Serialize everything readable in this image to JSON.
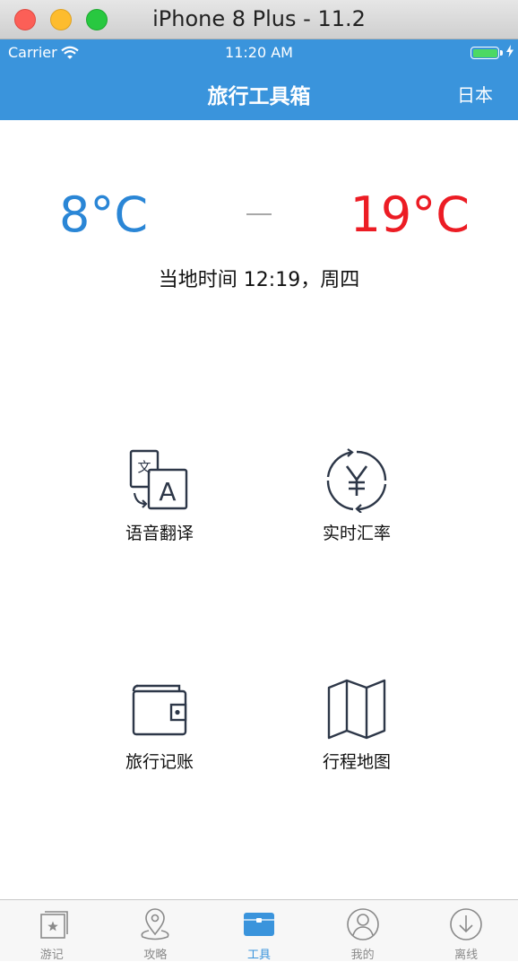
{
  "window": {
    "title": "iPhone 8 Plus - 11.2"
  },
  "status_bar": {
    "carrier": "Carrier",
    "time": "11:20 AM",
    "battery_level": 1.0
  },
  "nav": {
    "title": "旅行工具箱",
    "right": "日本"
  },
  "weather": {
    "low": "8°C",
    "high": "19°C",
    "local_time": "当地时间 12:19，周四"
  },
  "tools": [
    {
      "label": "语音翻译",
      "icon": "translate-icon"
    },
    {
      "label": "实时汇率",
      "icon": "currency-exchange-icon"
    },
    {
      "label": "旅行记账",
      "icon": "wallet-icon"
    },
    {
      "label": "行程地图",
      "icon": "map-icon"
    }
  ],
  "tabs": [
    {
      "label": "游记",
      "icon": "travel-notes-icon",
      "active": false
    },
    {
      "label": "攻略",
      "icon": "location-pin-icon",
      "active": false
    },
    {
      "label": "工具",
      "icon": "toolbox-icon",
      "active": true
    },
    {
      "label": "我的",
      "icon": "profile-icon",
      "active": false
    },
    {
      "label": "离线",
      "icon": "download-icon",
      "active": false
    }
  ],
  "colors": {
    "nav": "#3a94dc",
    "low_temp": "#2a86d6",
    "high_temp": "#ec1c24",
    "tab_active": "#3a94dc",
    "tab_inactive": "#8a8a8a"
  }
}
